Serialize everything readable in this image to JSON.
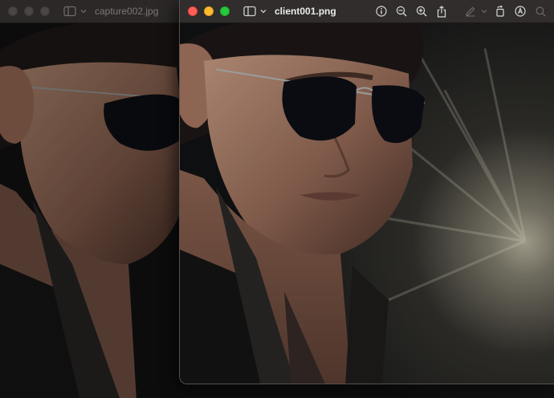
{
  "back_window": {
    "title": "capture002.jpg",
    "image_alt": "Photo of a man with dark hair wearing aviator sunglasses and a dark suit"
  },
  "front_window": {
    "title": "client001.png",
    "image_alt": "Photo of a man with dark hair wearing aviator sunglasses and a dark suit against a dark background with light rays"
  },
  "colors": {
    "traffic_close": "#ff5f57",
    "traffic_minimize": "#febc2e",
    "traffic_zoom": "#28c840",
    "titlebar": "#302d2c"
  },
  "icons": {
    "sidebar": "sidebar-icon",
    "chevron": "chevron-down-icon",
    "info": "info-icon",
    "zoom_out": "zoom-out-icon",
    "zoom_in": "zoom-in-icon",
    "share": "share-icon",
    "markup": "markup-pen-icon",
    "rotate": "rotate-icon",
    "annotate": "annotate-icon",
    "search": "search-icon"
  }
}
